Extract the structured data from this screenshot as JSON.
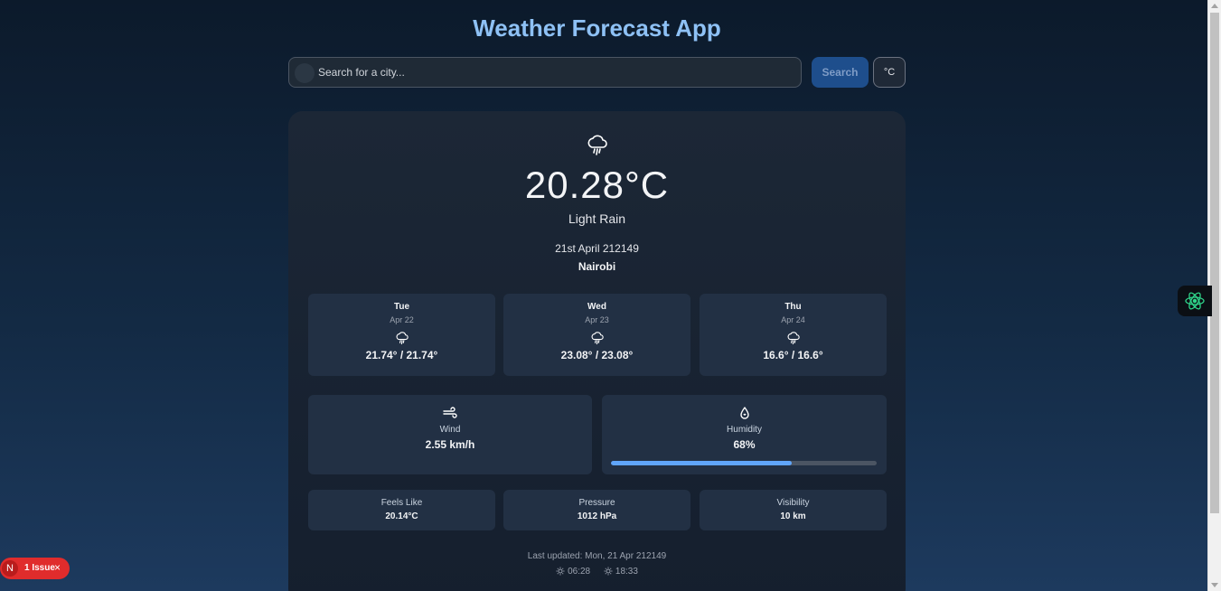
{
  "header": {
    "title": "Weather Forecast App"
  },
  "search": {
    "placeholder": "Search for a city...",
    "button_label": "Search",
    "unit_label": "°C"
  },
  "current": {
    "icon": "cloud-rain-icon",
    "temperature": "20.28°C",
    "condition": "Light Rain",
    "date": "21st April 212149",
    "city": "Nairobi"
  },
  "forecast": [
    {
      "day": "Tue",
      "date": "Apr 22",
      "icon": "cloud-rain-icon",
      "temps": "21.74° / 21.74°"
    },
    {
      "day": "Wed",
      "date": "Apr 23",
      "icon": "cloud-rain-icon",
      "temps": "23.08° / 23.08°"
    },
    {
      "day": "Thu",
      "date": "Apr 24",
      "icon": "cloud-rain-icon",
      "temps": "16.6° / 16.6°"
    }
  ],
  "wind": {
    "icon": "wind-icon",
    "label": "Wind",
    "value": "2.55 km/h"
  },
  "humidity": {
    "icon": "droplet-icon",
    "label": "Humidity",
    "value": "68%",
    "percent": 68
  },
  "details": [
    {
      "label": "Feels Like",
      "value": "20.14°C"
    },
    {
      "label": "Pressure",
      "value": "1012 hPa"
    },
    {
      "label": "Visibility",
      "value": "10 km"
    }
  ],
  "footer": {
    "updated": "Last updated: Mon, 21 Apr 212149",
    "sunrise": "06:28",
    "sunset": "18:33"
  },
  "dev_overlay": {
    "issue_logo": "N",
    "issue_text": "1 Issue",
    "close": "×"
  },
  "colors": {
    "title": "#8ec1f5",
    "accent": "#60a5fa",
    "issue": "#e02c2c"
  }
}
